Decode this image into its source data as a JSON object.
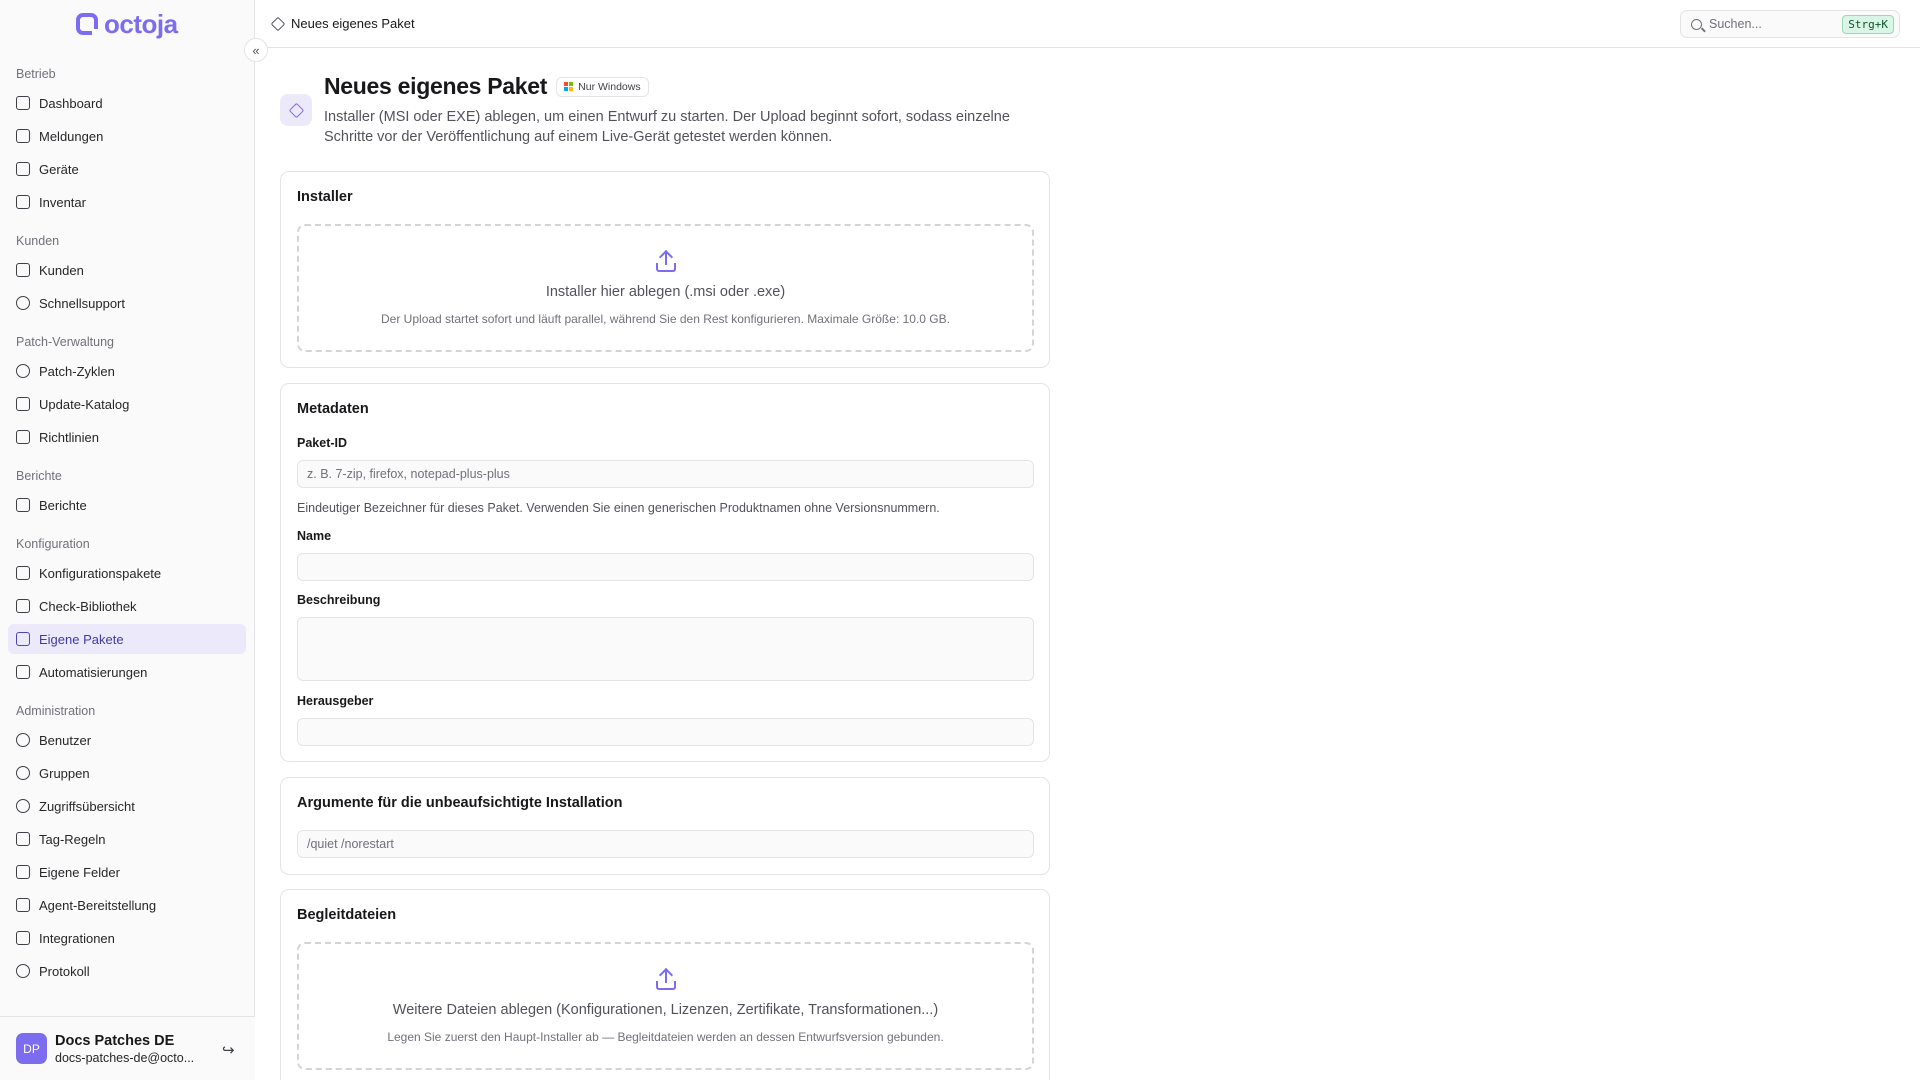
{
  "app": {
    "logo_text": "octoja",
    "accent": "#7c6cf0"
  },
  "sidebar": {
    "collapse_label": "«",
    "sections": [
      {
        "label": "Betrieb",
        "items": [
          {
            "label": "Dashboard",
            "icon": "dashboard-icon"
          },
          {
            "label": "Meldungen",
            "icon": "clipboard-icon"
          },
          {
            "label": "Geräte",
            "icon": "monitor-icon"
          },
          {
            "label": "Inventar",
            "icon": "boxes-icon"
          }
        ]
      },
      {
        "label": "Kunden",
        "items": [
          {
            "label": "Kunden",
            "icon": "building-icon"
          },
          {
            "label": "Schnellsupport",
            "icon": "headset-icon"
          }
        ]
      },
      {
        "label": "Patch-Verwaltung",
        "items": [
          {
            "label": "Patch-Zyklen",
            "icon": "shield-icon"
          },
          {
            "label": "Update-Katalog",
            "icon": "book-icon"
          },
          {
            "label": "Richtlinien",
            "icon": "list-icon"
          }
        ]
      },
      {
        "label": "Berichte",
        "items": [
          {
            "label": "Berichte",
            "icon": "file-icon"
          }
        ]
      },
      {
        "label": "Konfiguration",
        "items": [
          {
            "label": "Konfigurationspakete",
            "icon": "package-icon"
          },
          {
            "label": "Check-Bibliothek",
            "icon": "library-icon"
          },
          {
            "label": "Eigene Pakete",
            "icon": "package-icon",
            "active": true
          },
          {
            "label": "Automatisierungen",
            "icon": "workflow-icon"
          }
        ]
      },
      {
        "label": "Administration",
        "items": [
          {
            "label": "Benutzer",
            "icon": "user-icon"
          },
          {
            "label": "Gruppen",
            "icon": "users-icon"
          },
          {
            "label": "Zugriffsübersicht",
            "icon": "shield-check-icon"
          },
          {
            "label": "Tag-Regeln",
            "icon": "tag-icon"
          },
          {
            "label": "Eigene Felder",
            "icon": "sliders-icon"
          },
          {
            "label": "Agent-Bereitstellung",
            "icon": "rocket-icon"
          },
          {
            "label": "Integrationen",
            "icon": "plug-icon"
          },
          {
            "label": "Protokoll",
            "icon": "history-icon"
          }
        ]
      }
    ],
    "user": {
      "initials": "DP",
      "name": "Docs Patches DE",
      "email": "docs-patches-de@octo..."
    }
  },
  "topbar": {
    "breadcrumb": "Neues eigenes Paket",
    "search_placeholder": "Suchen...",
    "search_shortcut": "Strg+K"
  },
  "page": {
    "title": "Neues eigenes Paket",
    "badge": "Nur Windows",
    "description": "Installer (MSI oder EXE) ablegen, um einen Entwurf zu starten. Der Upload beginnt sofort, sodass einzelne Schritte vor der Veröffentlichung auf einem Live-Gerät getestet werden können."
  },
  "installer": {
    "title": "Installer",
    "drop_main": "Installer hier ablegen (.msi oder .exe)",
    "drop_sub": "Der Upload startet sofort und läuft parallel, während Sie den Rest konfigurieren. Maximale Größe: 10.0 GB."
  },
  "metadata": {
    "title": "Metadaten",
    "package_id_label": "Paket-ID",
    "package_id_placeholder": "z. B. 7-zip, firefox, notepad-plus-plus",
    "package_id_help": "Eindeutiger Bezeichner für dieses Paket. Verwenden Sie einen generischen Produktnamen ohne Versionsnummern.",
    "name_label": "Name",
    "name_value": "",
    "description_label": "Beschreibung",
    "description_value": "",
    "publisher_label": "Herausgeber",
    "publisher_value": ""
  },
  "silent_args": {
    "title": "Argumente für die unbeaufsichtigte Installation",
    "placeholder": "/quiet /norestart"
  },
  "companion": {
    "title": "Begleitdateien",
    "drop_main": "Weitere Dateien ablegen (Konfigurationen, Lizenzen, Zertifikate, Transformationen...)",
    "drop_sub": "Legen Sie zuerst den Haupt-Installer ab — Begleitdateien werden an dessen Entwurfsversion gebunden."
  }
}
